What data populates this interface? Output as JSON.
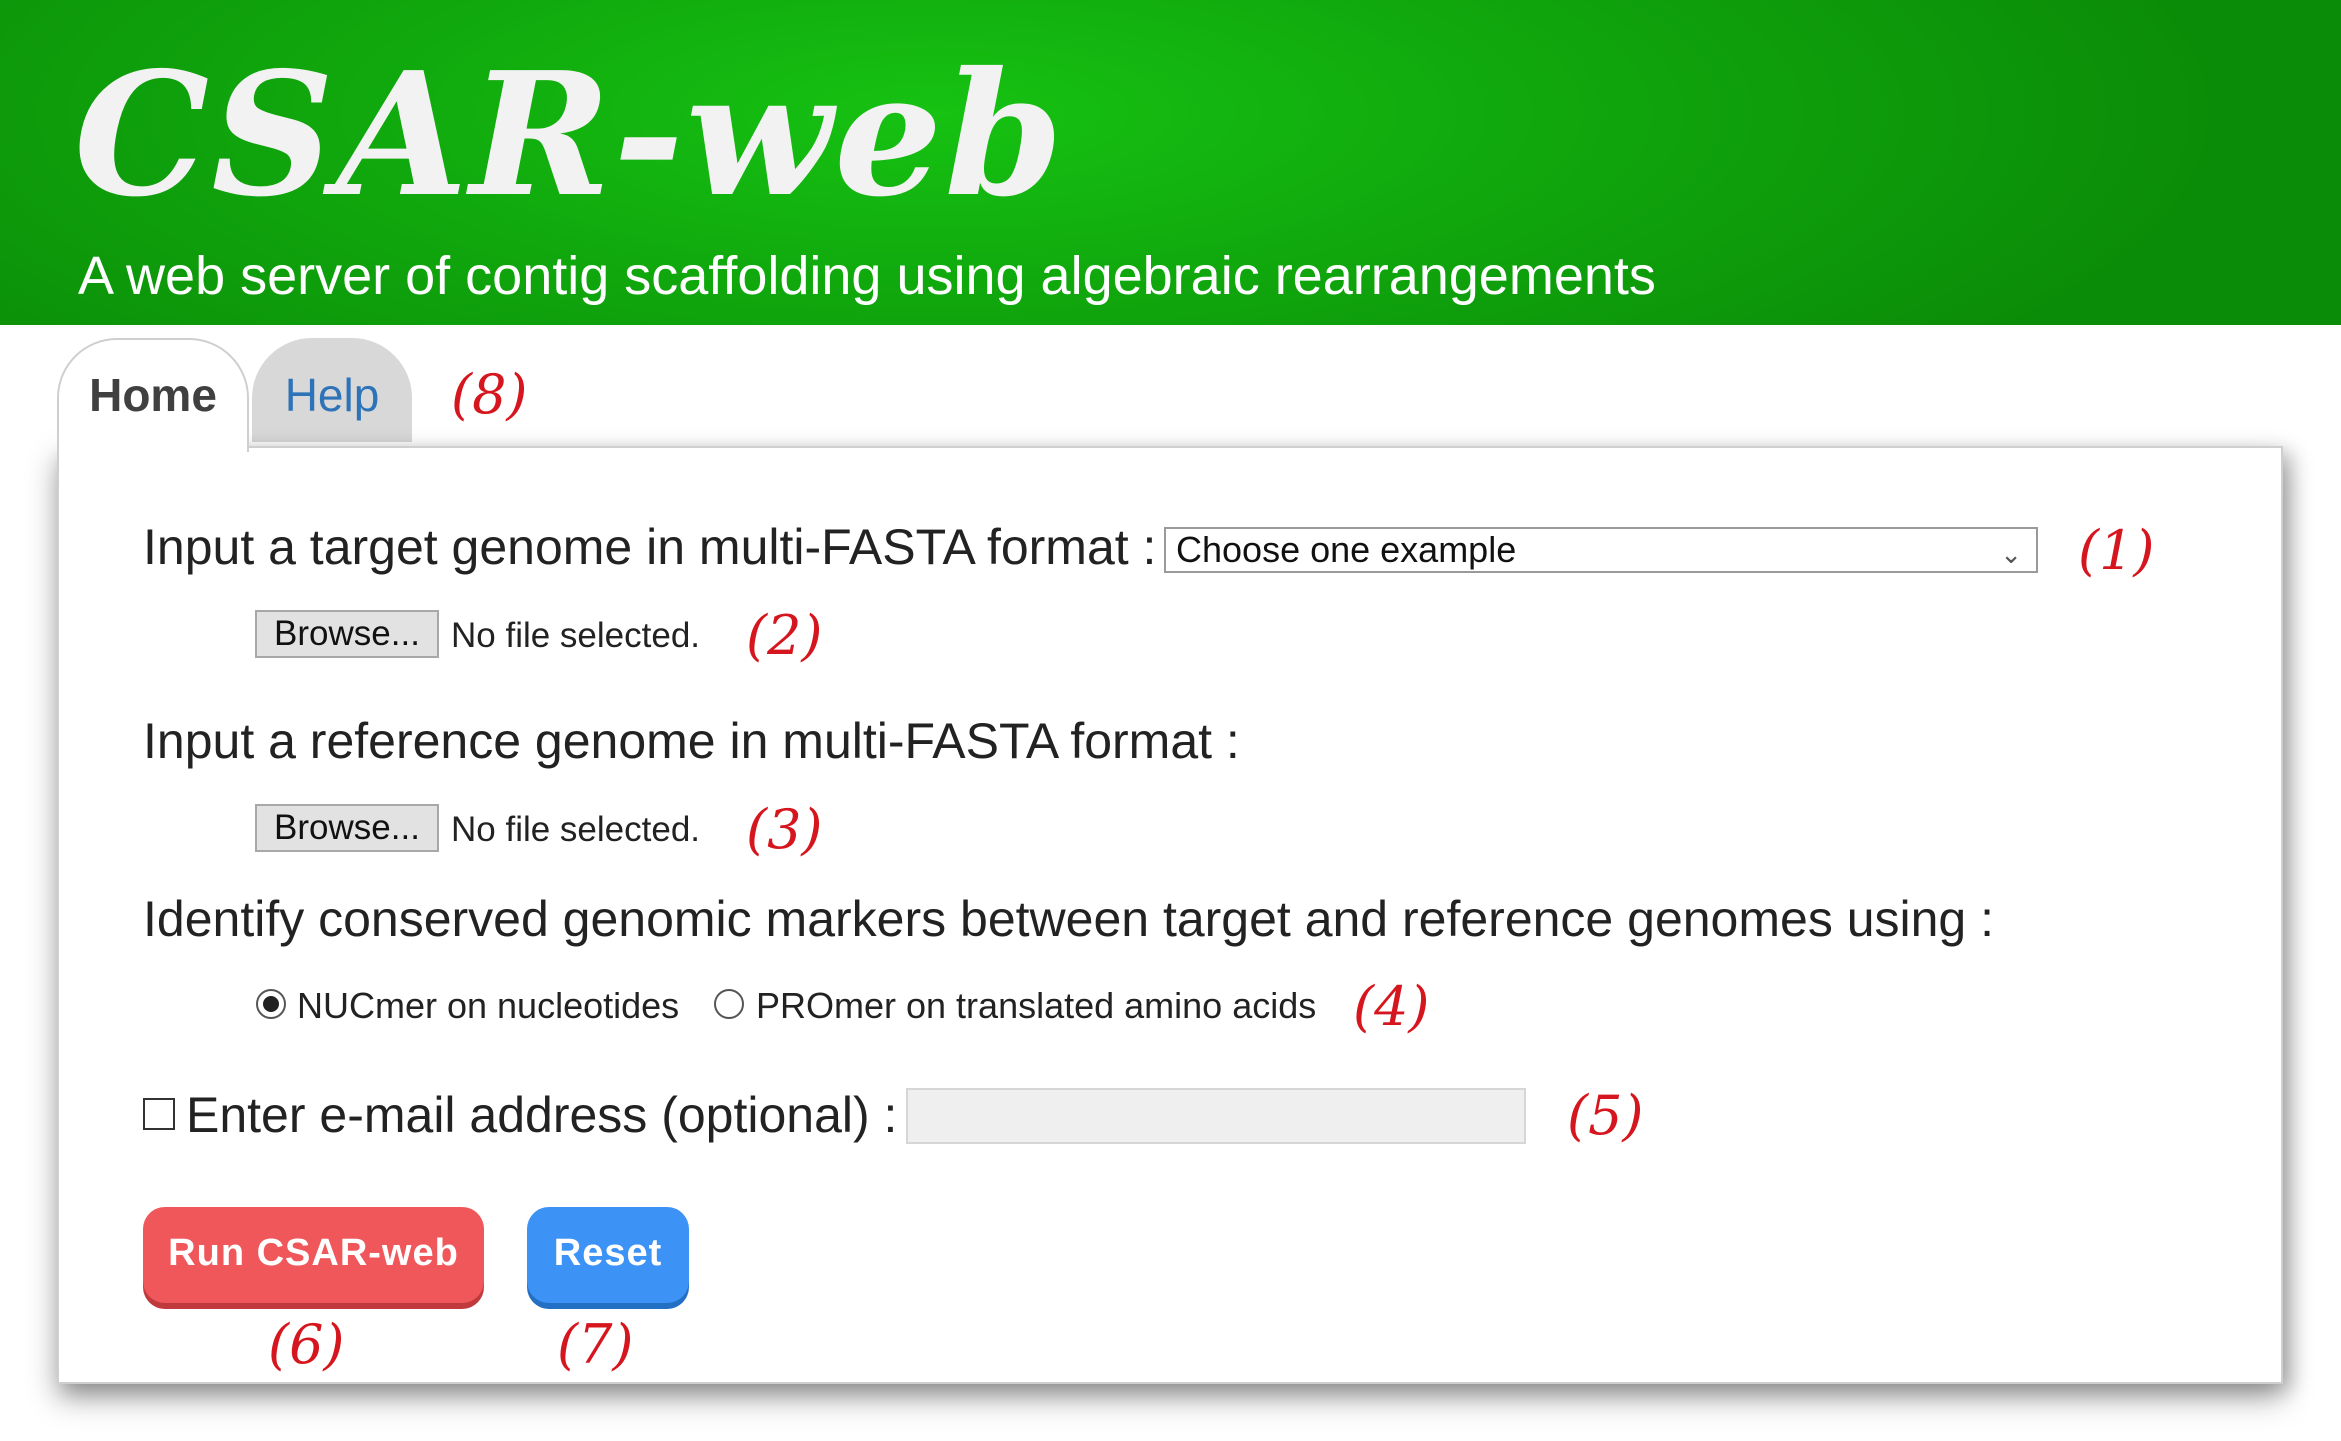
{
  "header": {
    "logo_text": "CSAR-web",
    "subtitle": "A web server of contig scaffolding using algebraic rearrangements"
  },
  "tabs": [
    {
      "label": "Home",
      "active": true
    },
    {
      "label": "Help",
      "active": false
    }
  ],
  "form": {
    "target_label": "Input a target genome in multi-FASTA format :",
    "example_select_value": "Choose one example",
    "target_browse_label": "Browse...",
    "target_file_status": "No file selected.",
    "reference_label": "Input a reference genome in multi-FASTA format :",
    "reference_browse_label": "Browse...",
    "reference_file_status": "No file selected.",
    "marker_label": "Identify conserved genomic markers between target and reference genomes using :",
    "options": [
      {
        "label": "NUCmer on nucleotides",
        "checked": true
      },
      {
        "label": "PROmer on translated amino acids",
        "checked": false
      }
    ],
    "email_label": "Enter e-mail address (optional) :",
    "email_checked": false,
    "email_value": "",
    "run_button_label": "Run CSAR-web",
    "reset_button_label": "Reset"
  },
  "annotations": {
    "a1": "(1)",
    "a2": "(2)",
    "a3": "(3)",
    "a4": "(4)",
    "a5": "(5)",
    "a6": "(6)",
    "a7": "(7)",
    "a8": "(8)"
  },
  "colors": {
    "header_green": "#10a80d",
    "run_button": "#f0575a",
    "reset_button": "#3d93f5",
    "annotation_red": "#d6161e",
    "help_tab_text": "#2e73b8"
  },
  "icons": {
    "select_arrow": "chevron-down-icon"
  }
}
